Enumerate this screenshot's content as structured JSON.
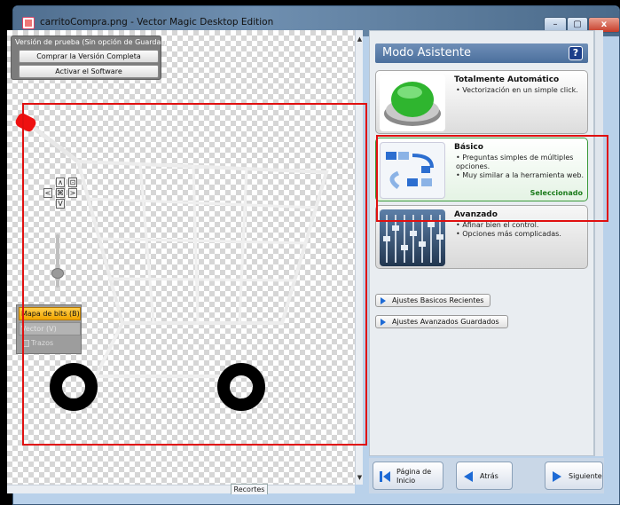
{
  "window": {
    "title": "carritoCompra.png - Vector Magic Desktop Edition",
    "minimize_label": "–",
    "maximize_label": "▢",
    "close_label": "x"
  },
  "trial": {
    "label": "Versión de prueba (Sin opción de Guardar)",
    "buy_label": "Comprar la Versión Completa",
    "activate_label": "Activar el Software"
  },
  "nav_control": {
    "up": "∧",
    "down": "V",
    "left": "<",
    "right": ">",
    "center": "⌘",
    "fit": "⊡"
  },
  "view_modes": {
    "bitmap": "Mapa de bits (B)",
    "vector": "Vector (V)",
    "strokes": "Trazos"
  },
  "canvas": {
    "tab_label": "Recortes"
  },
  "right_panel": {
    "title": "Modo Asistente",
    "help_label": "?",
    "cards": [
      {
        "title": "Totalmente Automático",
        "bullets": [
          "• Vectorización en un simple click."
        ]
      },
      {
        "title": "Básico",
        "bullets": [
          "• Preguntas simples de múltiples opciones.",
          "• Muy similar a la herramienta web."
        ],
        "selected_label": "Seleccionado"
      },
      {
        "title": "Avanzado",
        "bullets": [
          "• Afinar bien el control.",
          "• Opciones más complicadas."
        ]
      }
    ],
    "recent_label": "Ajustes Basicos Recientes",
    "saved_label": "Ajustes Avanzados Guardados"
  },
  "bottom_nav": {
    "home_label_1": "Página de",
    "home_label_2": "Inicio",
    "back_label": "Atrás",
    "next_label": "Siguiente"
  },
  "colors": {
    "annotation": "#e01010",
    "accent_blue": "#1d6ad5",
    "selected_green": "#1a7a1a"
  }
}
